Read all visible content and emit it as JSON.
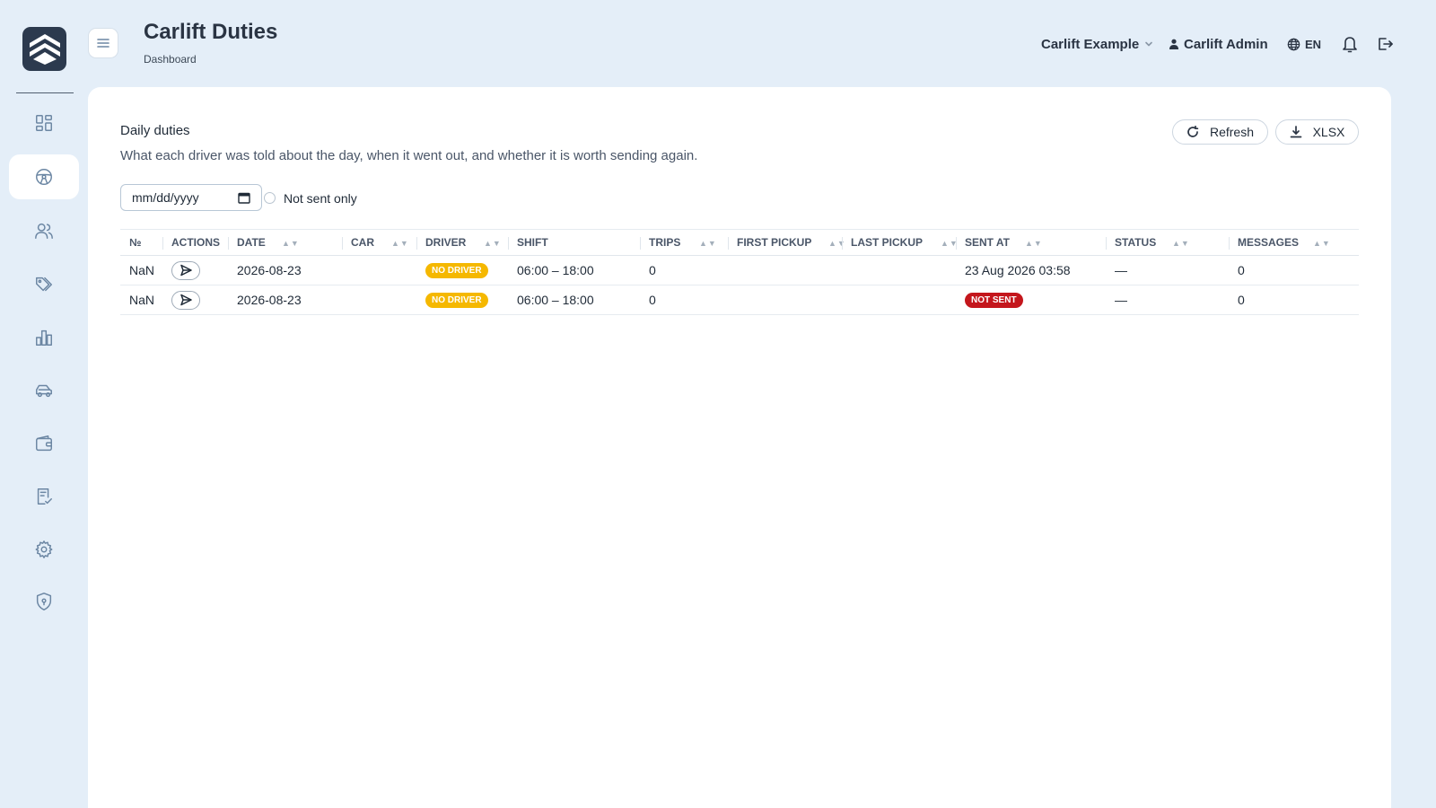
{
  "header": {
    "title": "Carlift Duties",
    "breadcrumb": "Dashboard",
    "company": "Carlift Example",
    "user": "Carlift Admin",
    "language": "EN"
  },
  "sidebar": {
    "items": [
      {
        "icon": "dashboard-icon",
        "active": false
      },
      {
        "icon": "steering-wheel-icon",
        "active": true
      },
      {
        "icon": "users-icon",
        "active": false
      },
      {
        "icon": "tags-icon",
        "active": false
      },
      {
        "icon": "bar-chart-icon",
        "active": false
      },
      {
        "icon": "car-icon",
        "active": false
      },
      {
        "icon": "wallet-icon",
        "active": false
      },
      {
        "icon": "checklist-icon",
        "active": false
      },
      {
        "icon": "gear-icon",
        "active": false
      },
      {
        "icon": "shield-icon",
        "active": false
      }
    ]
  },
  "card": {
    "title": "Daily duties",
    "subtitle": "What each driver was told about the day, when it went out, and whether it is worth sending again.",
    "refresh_label": "Refresh",
    "xlsx_label": "XLSX",
    "date_placeholder": "mm/dd/yyyy",
    "not_sent_label": "Not sent only"
  },
  "table": {
    "columns": [
      "№",
      "Actions",
      "Date",
      "Car",
      "Driver",
      "Shift",
      "Trips",
      "First pickup",
      "Last pickup",
      "Sent at",
      "Status",
      "Messages"
    ],
    "rows": [
      {
        "num": "NaN",
        "date": "2026-08-23",
        "car": "",
        "driver_badge": "No driver",
        "shift": "06:00 – 18:00",
        "trips": "0",
        "first_pickup": "",
        "last_pickup": "",
        "sent_at": "23 Aug 2026 03:58",
        "sent_badge": "",
        "status": "—",
        "messages": "0"
      },
      {
        "num": "NaN",
        "date": "2026-08-23",
        "car": "",
        "driver_badge": "No driver",
        "shift": "06:00 – 18:00",
        "trips": "0",
        "first_pickup": "",
        "last_pickup": "",
        "sent_at": "",
        "sent_badge": "Not sent",
        "status": "—",
        "messages": "0"
      }
    ]
  },
  "colors": {
    "background": "#e4eef8",
    "logo": "#2c3a4e",
    "badge_no_driver": "#f5b800",
    "badge_not_sent": "#c4161c"
  }
}
